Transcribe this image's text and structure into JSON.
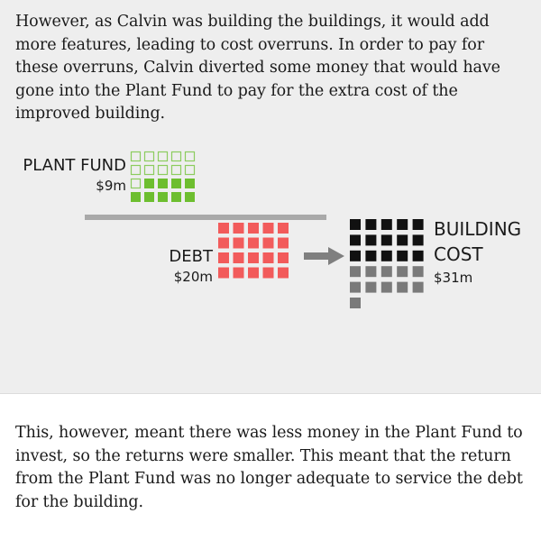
{
  "article": {
    "paragraph_before": "However, as Calvin was building the buildings, it would add more features, leading to cost overruns. In order to pay for these overruns, Calvin diverted some money that would have gone into the Plant Fund to pay for the extra cost of the improved building.",
    "paragraph_after": "This, however, meant there was less money in the Plant Fund to invest, so the returns were smaller. This meant that the return from the Plant Fund was no longer adequate to service the debt for the building."
  },
  "diagram": {
    "plant_fund": {
      "label": "PLANT FUND",
      "amount": "$9m",
      "units_filled": 9,
      "units_total": 20,
      "filled_color": "#6dbe2f",
      "empty_color": "#8ccc5e"
    },
    "debt": {
      "label": "DEBT",
      "amount": "$20m",
      "units": 20,
      "color": "#f25b5b"
    },
    "building_cost": {
      "label_line1": "BUILDING",
      "label_line2": "COST",
      "amount": "$31m",
      "units_dark": 15,
      "units_grey": 11,
      "dark_color": "#111111",
      "grey_color": "#7a7a7a"
    },
    "divider_color": "#a9a9a9",
    "arrow_color": "#7f7f7f"
  }
}
